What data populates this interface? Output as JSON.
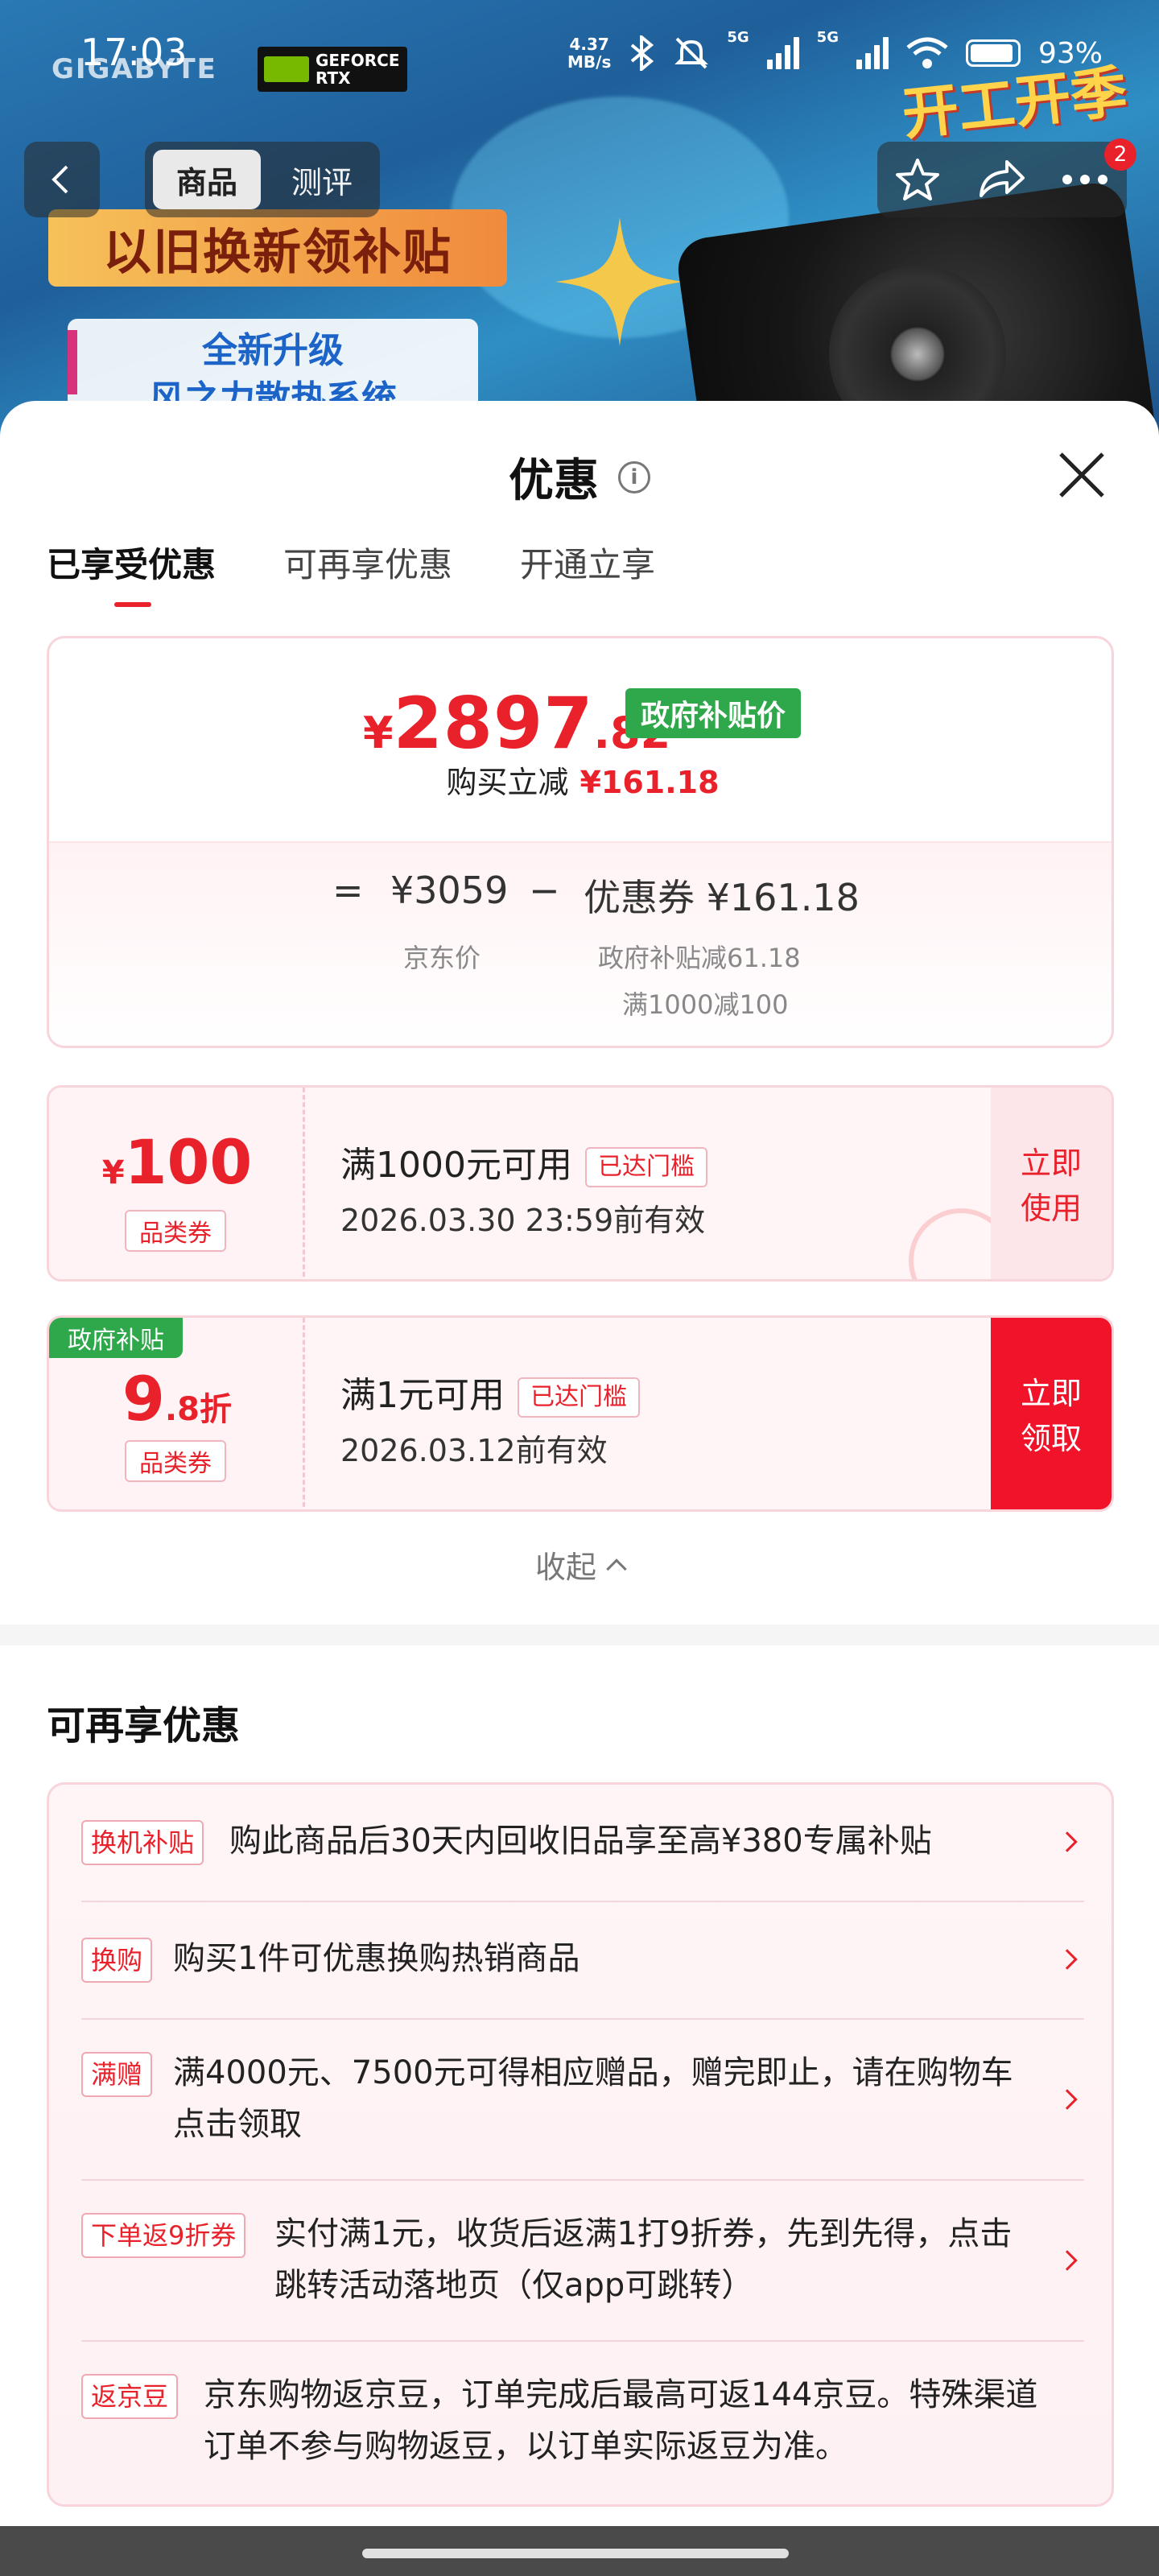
{
  "status_bar": {
    "time": "17:03",
    "net_speed_value": "4.37",
    "net_speed_unit": "MB/s",
    "net_label_1": "5G",
    "net_label_2": "5G",
    "battery": "93%"
  },
  "banner": {
    "brand": "GIGABYTE",
    "gpu_brand": "GEFORCE RTX",
    "headline": "以旧换新领补贴",
    "sub_line1": "全新升级",
    "sub_line2": "风之力散热系统",
    "corner_promo": "开工开季"
  },
  "top_nav": {
    "tabs": [
      "商品",
      "测评"
    ],
    "active_tab": "商品",
    "cart_badge": "2"
  },
  "sheet": {
    "title": "优惠",
    "tabs": [
      "已享受优惠",
      "可再享优惠",
      "开通立享"
    ],
    "active_tab": "已享受优惠",
    "price": {
      "currency": "¥",
      "integer": "2897",
      "decimal": ".82",
      "tag": "政府补贴价",
      "reduce_label": "购买立减",
      "reduce_amount": "¥161.18",
      "formula_eq": "=",
      "jd_price": "¥3059",
      "formula_minus": "−",
      "coupon_label": "优惠券 ¥161.18",
      "jd_price_label": "京东价",
      "detail_1": "政府补贴减61.18",
      "detail_2": "满1000减100"
    },
    "coupons": [
      {
        "currency": "¥",
        "value": "100",
        "type": "品类券",
        "condition": "满1000元可用",
        "status": "已达门槛",
        "expiry": "2026.03.30 23:59前有效",
        "button_line1": "立即",
        "button_line2": "使用"
      },
      {
        "gov_tag": "政府补贴",
        "value": "9",
        "value_decimal": ".8",
        "value_unit": "折",
        "type": "品类券",
        "condition": "满1元可用",
        "status": "已达门槛",
        "expiry": "2026.03.12前有效",
        "button_line1": "立即",
        "button_line2": "领取"
      }
    ],
    "collapse_label": "收起",
    "more_section": {
      "title": "可再享优惠",
      "items": [
        {
          "tag": "换机补贴",
          "text": "购此商品后30天内回收旧品享至高¥380专属补贴"
        },
        {
          "tag": "换购",
          "text": "购买1件可优惠换购热销商品"
        },
        {
          "tag": "满赠",
          "text_line1": "满4000元、7500元可得相应赠品，赠完即止，请在购物车",
          "text_line2": "点击领取"
        },
        {
          "tag": "下单返9折券",
          "text_line1": "实付满1元，收货后返满1打9折券，先到先得，点击",
          "text_line2": "跳转活动落地页（仅app可跳转）"
        },
        {
          "tag": "返京豆",
          "text_line1": "京东购物返京豆，订单完成后最高可返144京豆。特殊渠道",
          "text_line2": "订单不参与购物返豆，以订单实际返豆为准。"
        }
      ]
    }
  },
  "colors": {
    "accent_red": "#e8212b",
    "gov_green": "#2ea84a",
    "card_border": "#f7d5da"
  }
}
